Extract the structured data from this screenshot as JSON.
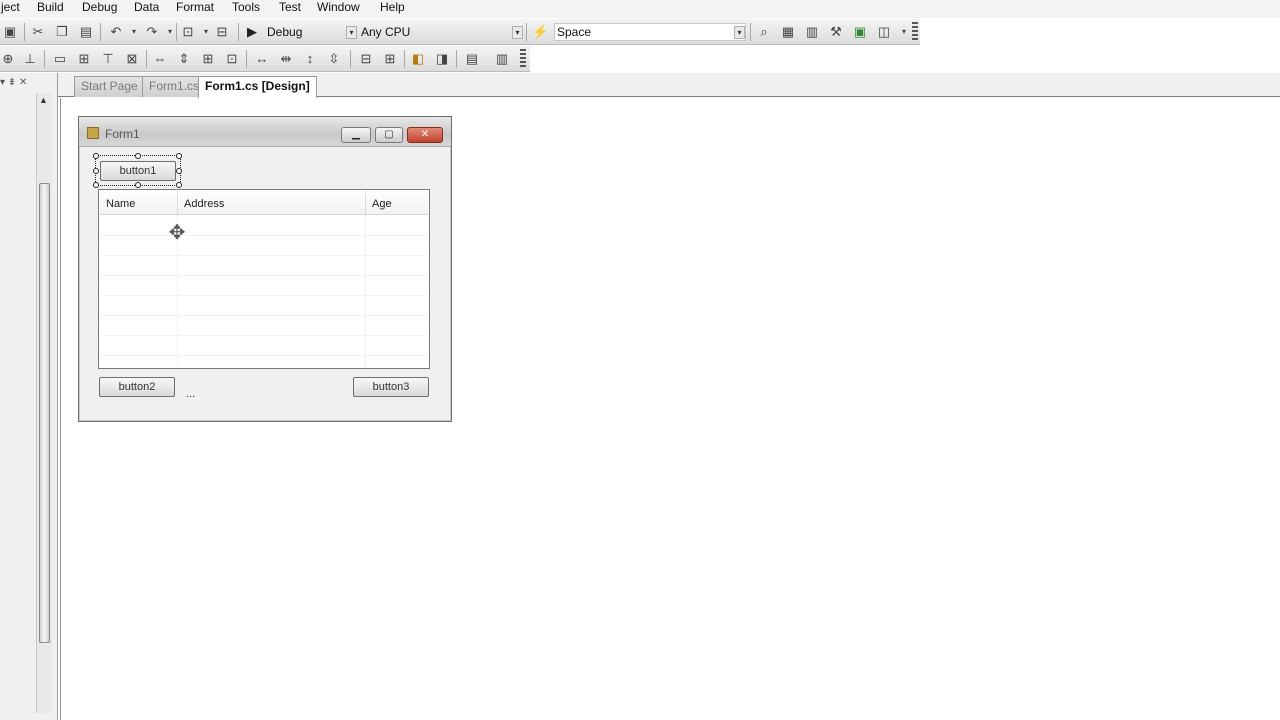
{
  "menu": [
    "ject",
    "Build",
    "Debug",
    "Data",
    "Format",
    "Tools",
    "Test",
    "Window",
    "Help"
  ],
  "toolbar": {
    "config": "Debug",
    "platform": "Any CPU",
    "find": "Space"
  },
  "tabs": [
    "Start Page",
    "Form1.cs",
    "Form1.cs [Design]"
  ],
  "form": {
    "title": "Form1",
    "button1": "button1",
    "button2": "button2",
    "button3": "button3",
    "columns": [
      "Name",
      "Address",
      "Age"
    ],
    "overflow": "..."
  }
}
